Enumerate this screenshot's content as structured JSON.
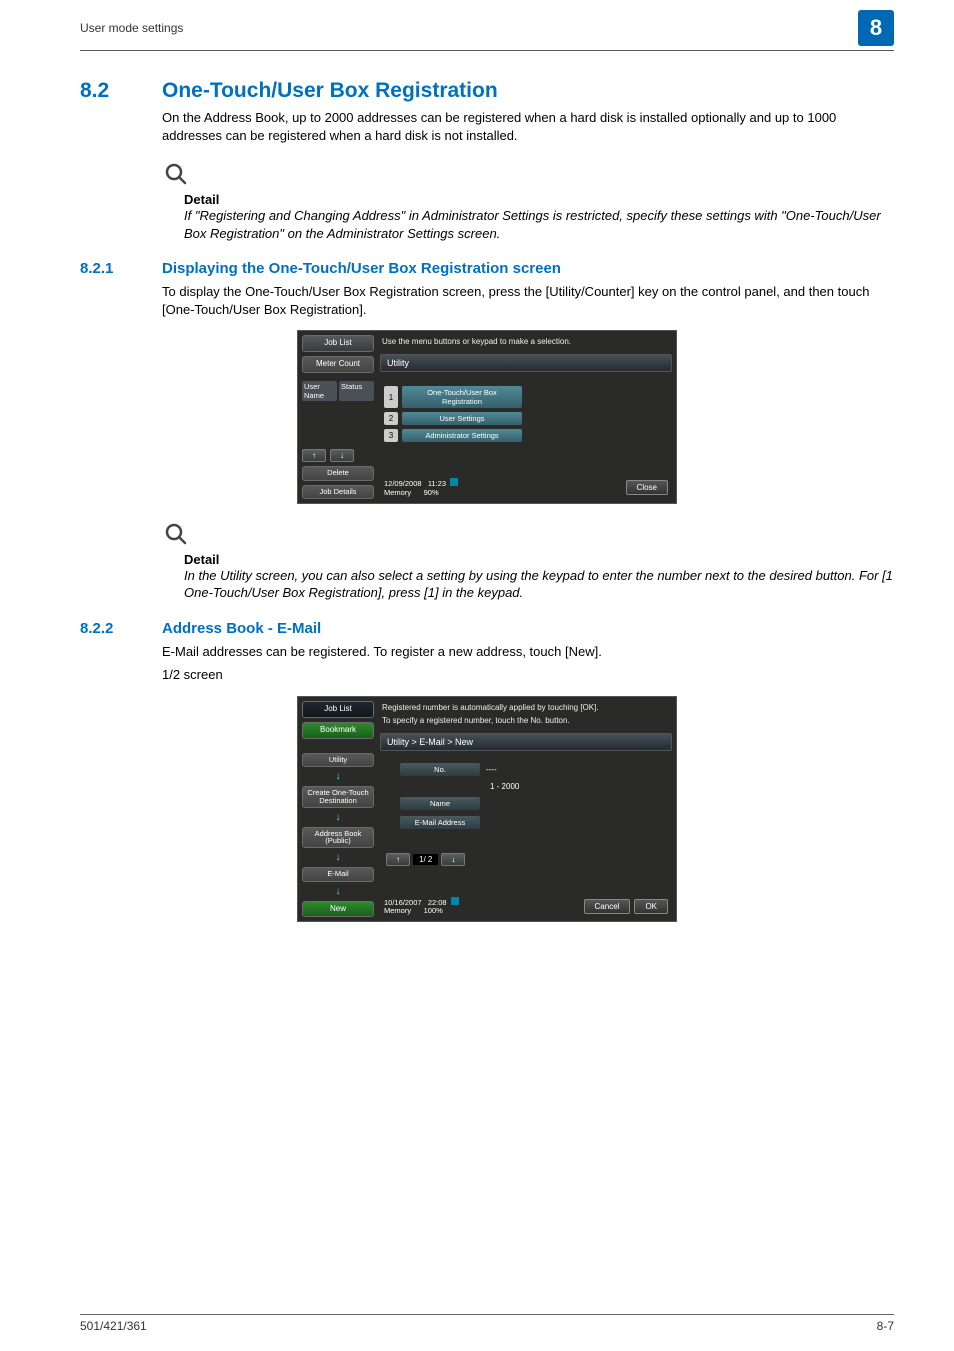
{
  "header": {
    "left": "User mode settings",
    "chapter": "8"
  },
  "s82": {
    "num": "8.2",
    "title": "One-Touch/User Box Registration",
    "para": "On the Address Book, up to 2000 addresses can be registered when a hard disk is installed optionally and up to 1000 addresses can be registered when a hard disk is not installed."
  },
  "detail1": {
    "label": "Detail",
    "text": "If \"Registering and Changing Address\" in Administrator Settings is restricted, specify these settings with \"One-Touch/User Box Registration\" on the Administrator Settings screen."
  },
  "s821": {
    "num": "8.2.1",
    "title": "Displaying the One-Touch/User Box Registration screen",
    "para": "To display the One-Touch/User Box Registration screen, press the [Utility/Counter] key on the control panel, and then touch [One-Touch/User Box Registration]."
  },
  "panel1": {
    "side": {
      "job_list": "Job List",
      "meter_count": "Meter Count",
      "col1": "User Name",
      "col2": "Status",
      "delete": "Delete",
      "job_details": "Job Details"
    },
    "msg": "Use the menu buttons or keypad to make a selection.",
    "titlebar": "Utility",
    "menu": [
      {
        "n": "1",
        "label": "One-Touch/User Box Registration"
      },
      {
        "n": "2",
        "label": "User Settings"
      },
      {
        "n": "3",
        "label": "Administrator Settings"
      }
    ],
    "status_date": "12/09/2008",
    "status_time": "11:23",
    "status_mem_label": "Memory",
    "status_mem_val": "90%",
    "close": "Close"
  },
  "detail2": {
    "label": "Detail",
    "text": "In the Utility screen, you can also select a setting by using the keypad to enter the number next to the desired button. For [1 One-Touch/User Box Registration], press [1] in the keypad."
  },
  "s822": {
    "num": "8.2.2",
    "title": "Address Book - E-Mail",
    "para1": "E-Mail addresses can be registered. To register a new address, touch [New].",
    "para2": "1/2 screen"
  },
  "panel2": {
    "side": {
      "job_list": "Job List",
      "bookmark": "Bookmark",
      "utility": "Utility",
      "create": "Create One-Touch Destination",
      "abook": "Address Book (Public)",
      "email": "E-Mail",
      "new": "New"
    },
    "msg1": "Registered number is automatically applied by touching [OK].",
    "msg2": "To specify a registered number, touch the No. button.",
    "titlebar": "Utility > E-Mail > New",
    "fields": {
      "no_label": "No.",
      "no_val": "----",
      "no_range": "1 - 2000",
      "name_label": "Name",
      "email_label": "E-Mail Address"
    },
    "pager": "1/ 2",
    "status_date": "10/16/2007",
    "status_time": "22:08",
    "status_mem_label": "Memory",
    "status_mem_val": "100%",
    "cancel": "Cancel",
    "ok": "OK"
  },
  "footer": {
    "left": "501/421/361",
    "right": "8-7"
  }
}
